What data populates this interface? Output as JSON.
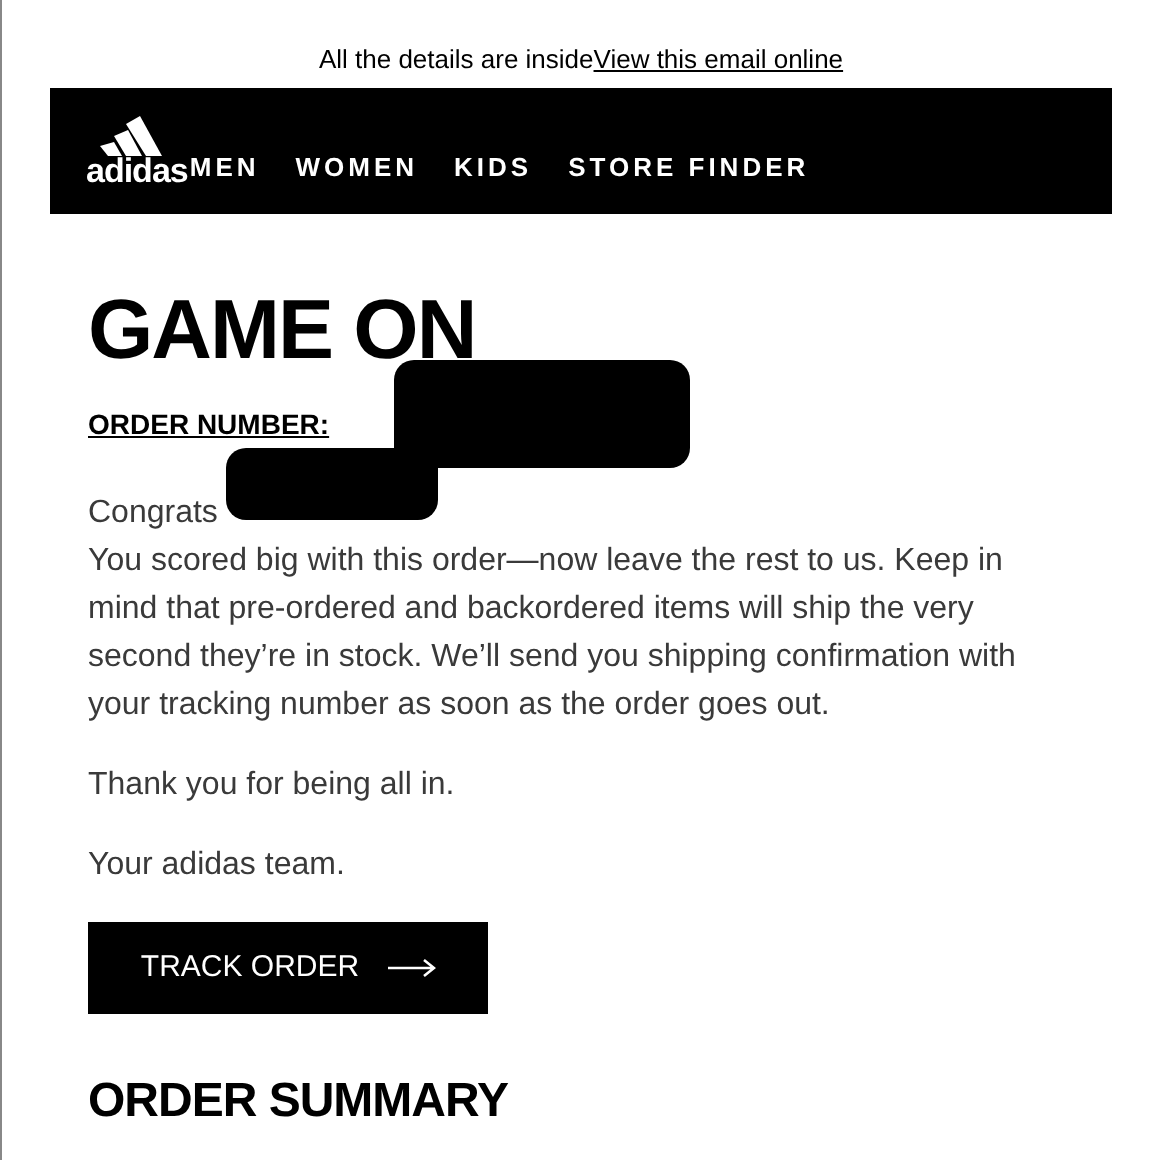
{
  "preheader": {
    "text": "All the details are inside",
    "link": "View this email online"
  },
  "header": {
    "brand": "adidas",
    "nav": [
      "MEN",
      "WOMEN",
      "KIDS",
      "STORE FINDER"
    ]
  },
  "headline": "GAME ON",
  "order_number_label": "ORDER NUMBER:",
  "greeting": "Congrats",
  "paragraphs": [
    "You scored big with this order—now leave the rest to us. Keep in mind that pre-ordered and backordered items will ship the very second they’re in stock. We’ll send you shipping confirmation with your tracking number as soon as the order goes out.",
    "Thank you for being all in.",
    "Your adidas team."
  ],
  "button": "TRACK ORDER",
  "section_title": "ORDER SUMMARY"
}
